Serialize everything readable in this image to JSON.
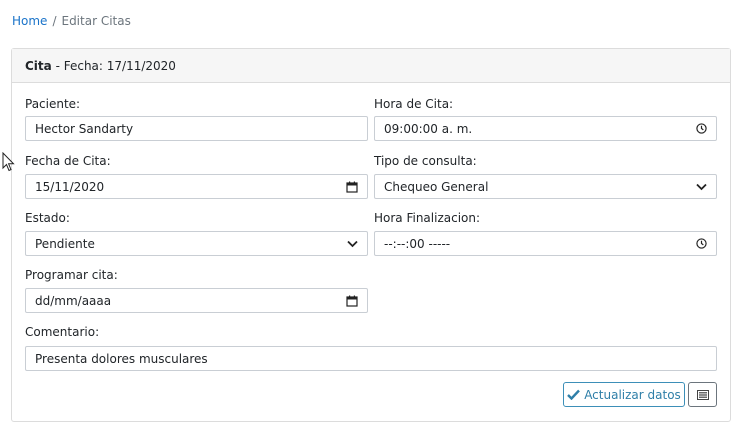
{
  "breadcrumb": {
    "home": "Home",
    "separator": "/",
    "current": "Editar Citas"
  },
  "card": {
    "title_bold": "Cita",
    "title_rest": " - Fecha: 17/11/2020"
  },
  "form": {
    "paciente": {
      "label": "Paciente:",
      "value": "Hector Sandarty",
      "icon": ""
    },
    "hora_cita": {
      "label": "Hora de Cita:",
      "value": "09:00:00 a. m.",
      "icon": "clock-icon"
    },
    "fecha_cita": {
      "label": "Fecha de Cita:",
      "value": "15/11/2020",
      "icon": "calendar-icon"
    },
    "tipo_consulta": {
      "label": "Tipo de consulta:",
      "value": "Chequeo General",
      "icon": "chevron-down-icon"
    },
    "estado": {
      "label": "Estado:",
      "value": "Pendiente",
      "icon": "chevron-down-icon"
    },
    "hora_finalizacion": {
      "label": "Hora Finalizacion:",
      "value": "--:--:00 -----",
      "icon": "clock-icon"
    },
    "programar_cita": {
      "label": "Programar cita:",
      "placeholder": "dd/mm/aaaa",
      "icon": "calendar-icon"
    },
    "comentario": {
      "label": "Comentario:",
      "value": "Presenta dolores musculares"
    }
  },
  "actions": {
    "update_label": "Actualizar datos",
    "list_icon": "list-icon"
  },
  "colors": {
    "link": "#1a73c9",
    "accent": "#3d8fb8",
    "border": "#c9ced4"
  }
}
